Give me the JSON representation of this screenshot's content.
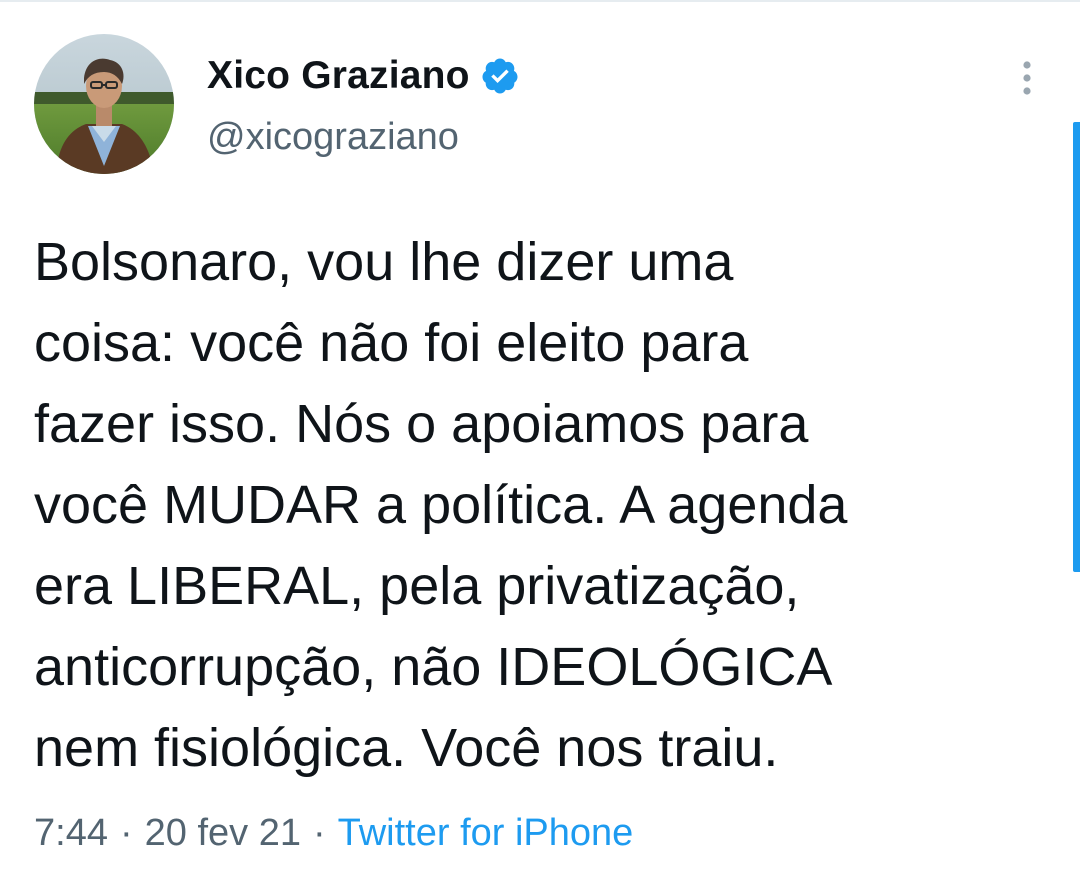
{
  "tweet": {
    "author": {
      "display_name": "Xico Graziano",
      "handle": "@xicograziano",
      "verified": true,
      "avatar_icon": "profile-photo"
    },
    "more_icon": "more-vertical-icon",
    "text_lines": [
      "Bolsonaro, vou lhe dizer uma",
      "coisa: você não foi eleito para",
      "fazer isso. Nós o apoiamos para",
      "você MUDAR a política. A agenda",
      "era LIBERAL, pela privatização,",
      "anticorrupção, não IDEOLÓGICA",
      "nem fisiológica. Você nos traiu."
    ],
    "meta": {
      "time": "7:44",
      "separator": "·",
      "date": "20 fev 21",
      "source": "Twitter for iPhone"
    }
  },
  "colors": {
    "accent": "#1d9bf0",
    "text_primary": "#0f1419",
    "text_secondary": "#536471",
    "divider": "#e6ecf0"
  }
}
